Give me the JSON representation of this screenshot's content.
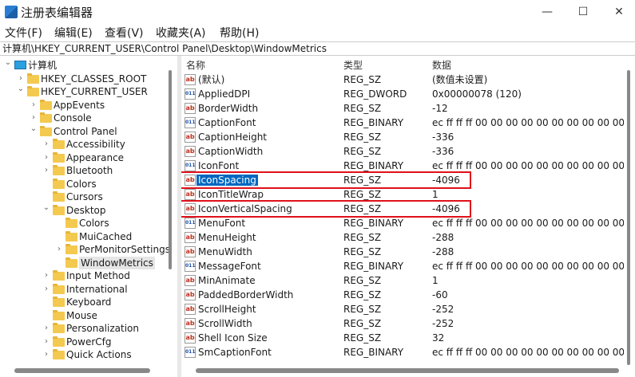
{
  "window": {
    "title": "注册表编辑器",
    "minimize": "—",
    "maximize": "☐",
    "close": "✕"
  },
  "menu": [
    "文件(F)",
    "编辑(E)",
    "查看(V)",
    "收藏夹(A)",
    "帮助(H)"
  ],
  "address": "计算机\\HKEY_CURRENT_USER\\Control Panel\\Desktop\\WindowMetrics",
  "tree": [
    {
      "label": "计算机",
      "level": 0,
      "state": "expanded",
      "icon": "computer"
    },
    {
      "label": "HKEY_CLASSES_ROOT",
      "level": 1,
      "state": "collapsed"
    },
    {
      "label": "HKEY_CURRENT_USER",
      "level": 1,
      "state": "expanded"
    },
    {
      "label": "AppEvents",
      "level": 2,
      "state": "collapsed"
    },
    {
      "label": "Console",
      "level": 2,
      "state": "collapsed"
    },
    {
      "label": "Control Panel",
      "level": 2,
      "state": "expanded"
    },
    {
      "label": "Accessibility",
      "level": 3,
      "state": "collapsed"
    },
    {
      "label": "Appearance",
      "level": 3,
      "state": "collapsed"
    },
    {
      "label": "Bluetooth",
      "level": 3,
      "state": "collapsed"
    },
    {
      "label": "Colors",
      "level": 3,
      "state": "leaf"
    },
    {
      "label": "Cursors",
      "level": 3,
      "state": "leaf"
    },
    {
      "label": "Desktop",
      "level": 3,
      "state": "expanded"
    },
    {
      "label": "Colors",
      "level": 4,
      "state": "leaf"
    },
    {
      "label": "MuiCached",
      "level": 4,
      "state": "leaf"
    },
    {
      "label": "PerMonitorSettings",
      "level": 4,
      "state": "collapsed"
    },
    {
      "label": "WindowMetrics",
      "level": 4,
      "state": "leaf",
      "selected": true
    },
    {
      "label": "Input Method",
      "level": 3,
      "state": "collapsed"
    },
    {
      "label": "International",
      "level": 3,
      "state": "collapsed"
    },
    {
      "label": "Keyboard",
      "level": 3,
      "state": "leaf"
    },
    {
      "label": "Mouse",
      "level": 3,
      "state": "leaf"
    },
    {
      "label": "Personalization",
      "level": 3,
      "state": "collapsed"
    },
    {
      "label": "PowerCfg",
      "level": 3,
      "state": "collapsed"
    },
    {
      "label": "Quick Actions",
      "level": 3,
      "state": "collapsed"
    }
  ],
  "list": {
    "headers": {
      "name": "名称",
      "type": "类型",
      "data": "数据"
    },
    "rows": [
      {
        "name": "(默认)",
        "type": "REG_SZ",
        "data": "(数值未设置)",
        "icon": "ab"
      },
      {
        "name": "AppliedDPI",
        "type": "REG_DWORD",
        "data": "0x00000078 (120)",
        "icon": "bin"
      },
      {
        "name": "BorderWidth",
        "type": "REG_SZ",
        "data": "-12",
        "icon": "ab"
      },
      {
        "name": "CaptionFont",
        "type": "REG_BINARY",
        "data": "ec ff ff ff 00 00 00 00 00 00 00 00 00 00 00 00 00 00",
        "icon": "bin"
      },
      {
        "name": "CaptionHeight",
        "type": "REG_SZ",
        "data": "-336",
        "icon": "ab"
      },
      {
        "name": "CaptionWidth",
        "type": "REG_SZ",
        "data": "-336",
        "icon": "ab"
      },
      {
        "name": "IconFont",
        "type": "REG_BINARY",
        "data": "ec ff ff ff 00 00 00 00 00 00 00 00 00 00 00 00 00 00",
        "icon": "bin"
      },
      {
        "name": "IconSpacing",
        "type": "REG_SZ",
        "data": "-4096",
        "icon": "ab",
        "selected": true,
        "highlighted": true
      },
      {
        "name": "IconTitleWrap",
        "type": "REG_SZ",
        "data": "1",
        "icon": "ab"
      },
      {
        "name": "IconVerticalSpacing",
        "type": "REG_SZ",
        "data": "-4096",
        "icon": "ab",
        "highlighted": true
      },
      {
        "name": "MenuFont",
        "type": "REG_BINARY",
        "data": "ec ff ff ff 00 00 00 00 00 00 00 00 00 00 00 00 00 00",
        "icon": "bin"
      },
      {
        "name": "MenuHeight",
        "type": "REG_SZ",
        "data": "-288",
        "icon": "ab"
      },
      {
        "name": "MenuWidth",
        "type": "REG_SZ",
        "data": "-288",
        "icon": "ab"
      },
      {
        "name": "MessageFont",
        "type": "REG_BINARY",
        "data": "ec ff ff ff 00 00 00 00 00 00 00 00 00 00 00 00 00 00",
        "icon": "bin"
      },
      {
        "name": "MinAnimate",
        "type": "REG_SZ",
        "data": "1",
        "icon": "ab"
      },
      {
        "name": "PaddedBorderWidth",
        "type": "REG_SZ",
        "data": "-60",
        "icon": "ab"
      },
      {
        "name": "ScrollHeight",
        "type": "REG_SZ",
        "data": "-252",
        "icon": "ab"
      },
      {
        "name": "ScrollWidth",
        "type": "REG_SZ",
        "data": "-252",
        "icon": "ab"
      },
      {
        "name": "Shell Icon Size",
        "type": "REG_SZ",
        "data": "32",
        "icon": "ab"
      },
      {
        "name": "SmCaptionFont",
        "type": "REG_BINARY",
        "data": "ec ff ff ff 00 00 00 00 00 00 00 00 00 00 00 00 00 00",
        "icon": "bin"
      }
    ]
  },
  "colors": {
    "selection": "#0067c0",
    "highlight_box": "#e0101a",
    "folder": "#f4c94f"
  }
}
